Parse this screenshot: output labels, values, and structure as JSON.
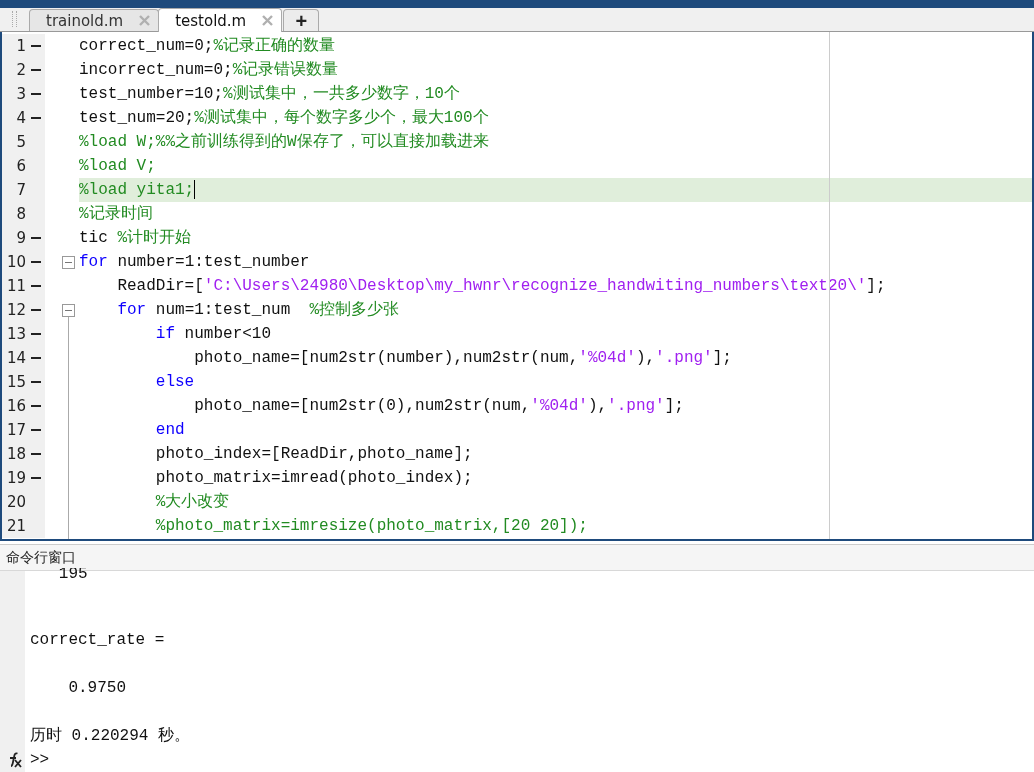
{
  "tabs": [
    {
      "label": "trainold.m",
      "selected": false
    },
    {
      "label": "testold.m",
      "selected": true
    }
  ],
  "new_tab": {
    "label": "+"
  },
  "editor": {
    "lines": [
      {
        "number": "1",
        "breakpoint": true,
        "tokens": [
          {
            "kind": "plain",
            "text": "correct_num=0;"
          },
          {
            "kind": "comment",
            "text": "%记录正确的数量"
          }
        ]
      },
      {
        "number": "2",
        "breakpoint": true,
        "tokens": [
          {
            "kind": "plain",
            "text": "incorrect_num=0;"
          },
          {
            "kind": "comment",
            "text": "%记录错误数量"
          }
        ]
      },
      {
        "number": "3",
        "breakpoint": true,
        "tokens": [
          {
            "kind": "plain",
            "text": "test_number=10;"
          },
          {
            "kind": "comment",
            "text": "%测试集中，一共多少数字，10个"
          }
        ]
      },
      {
        "number": "4",
        "breakpoint": true,
        "tokens": [
          {
            "kind": "plain",
            "text": "test_num=20;"
          },
          {
            "kind": "comment",
            "text": "%测试集中，每个数字多少个，最大100个"
          }
        ]
      },
      {
        "number": "5",
        "breakpoint": false,
        "tokens": [
          {
            "kind": "comment",
            "text": "%load W;%%之前训练得到的W保存了，可以直接加载进来"
          }
        ]
      },
      {
        "number": "6",
        "breakpoint": false,
        "tokens": [
          {
            "kind": "comment",
            "text": "%load V;"
          }
        ]
      },
      {
        "number": "7",
        "breakpoint": false,
        "current": true,
        "tokens": [
          {
            "kind": "comment",
            "text": "%load yita1;"
          }
        ]
      },
      {
        "number": "8",
        "breakpoint": false,
        "tokens": [
          {
            "kind": "comment",
            "text": "%记录时间"
          }
        ]
      },
      {
        "number": "9",
        "breakpoint": true,
        "tokens": [
          {
            "kind": "plain",
            "text": "tic "
          },
          {
            "kind": "comment",
            "text": "%计时开始"
          }
        ]
      },
      {
        "number": "10",
        "breakpoint": true,
        "fold": true,
        "tokens": [
          {
            "kind": "keyword",
            "text": "for"
          },
          {
            "kind": "plain",
            "text": " number=1:test_number"
          }
        ]
      },
      {
        "number": "11",
        "breakpoint": true,
        "tokens": [
          {
            "kind": "plain",
            "text": "    ReadDir=["
          },
          {
            "kind": "string",
            "text": "'C:\\Users\\24980\\Desktop\\my_hwnr\\recognize_handwiting_numbers\\text20\\'"
          },
          {
            "kind": "plain",
            "text": "];"
          }
        ]
      },
      {
        "number": "12",
        "breakpoint": true,
        "fold": true,
        "tokens": [
          {
            "kind": "keyword",
            "text": "    for"
          },
          {
            "kind": "plain",
            "text": " num=1:test_num  "
          },
          {
            "kind": "comment",
            "text": "%控制多少张"
          }
        ]
      },
      {
        "number": "13",
        "breakpoint": true,
        "tokens": [
          {
            "kind": "keyword",
            "text": "        if"
          },
          {
            "kind": "plain",
            "text": " number<10"
          }
        ]
      },
      {
        "number": "14",
        "breakpoint": true,
        "tokens": [
          {
            "kind": "plain",
            "text": "            photo_name=[num2str(number),num2str(num,"
          },
          {
            "kind": "string",
            "text": "'%04d'"
          },
          {
            "kind": "plain",
            "text": "),"
          },
          {
            "kind": "string",
            "text": "'.png'"
          },
          {
            "kind": "plain",
            "text": "];"
          }
        ]
      },
      {
        "number": "15",
        "breakpoint": true,
        "tokens": [
          {
            "kind": "keyword",
            "text": "        else"
          }
        ]
      },
      {
        "number": "16",
        "breakpoint": true,
        "tokens": [
          {
            "kind": "plain",
            "text": "            photo_name=[num2str(0),num2str(num,"
          },
          {
            "kind": "string",
            "text": "'%04d'"
          },
          {
            "kind": "plain",
            "text": "),"
          },
          {
            "kind": "string",
            "text": "'.png'"
          },
          {
            "kind": "plain",
            "text": "];"
          }
        ]
      },
      {
        "number": "17",
        "breakpoint": true,
        "tokens": [
          {
            "kind": "keyword",
            "text": "        end"
          }
        ]
      },
      {
        "number": "18",
        "breakpoint": true,
        "tokens": [
          {
            "kind": "plain",
            "text": "        photo_index=[ReadDir,photo_name];"
          }
        ]
      },
      {
        "number": "19",
        "breakpoint": true,
        "tokens": [
          {
            "kind": "plain",
            "text": "        photo_matrix=imread(photo_index);"
          }
        ]
      },
      {
        "number": "20",
        "breakpoint": false,
        "tokens": [
          {
            "kind": "comment",
            "text": "        %大小改变"
          }
        ]
      },
      {
        "number": "21",
        "breakpoint": false,
        "tokens": [
          {
            "kind": "comment",
            "text": "        %photo_matrix=imresize(photo_matrix,[20 20]);"
          }
        ]
      }
    ]
  },
  "command_window": {
    "title": "命令行窗口",
    "output": [
      {
        "kind": "partial",
        "text": "   195"
      },
      {
        "kind": "blank"
      },
      {
        "kind": "blank"
      },
      {
        "kind": "text",
        "text": "correct_rate ="
      },
      {
        "kind": "blank"
      },
      {
        "kind": "text",
        "text": "    0.9750"
      },
      {
        "kind": "blank"
      },
      {
        "kind": "text",
        "text": "历时 0.220294 秒。"
      }
    ],
    "prompt": ">>"
  }
}
